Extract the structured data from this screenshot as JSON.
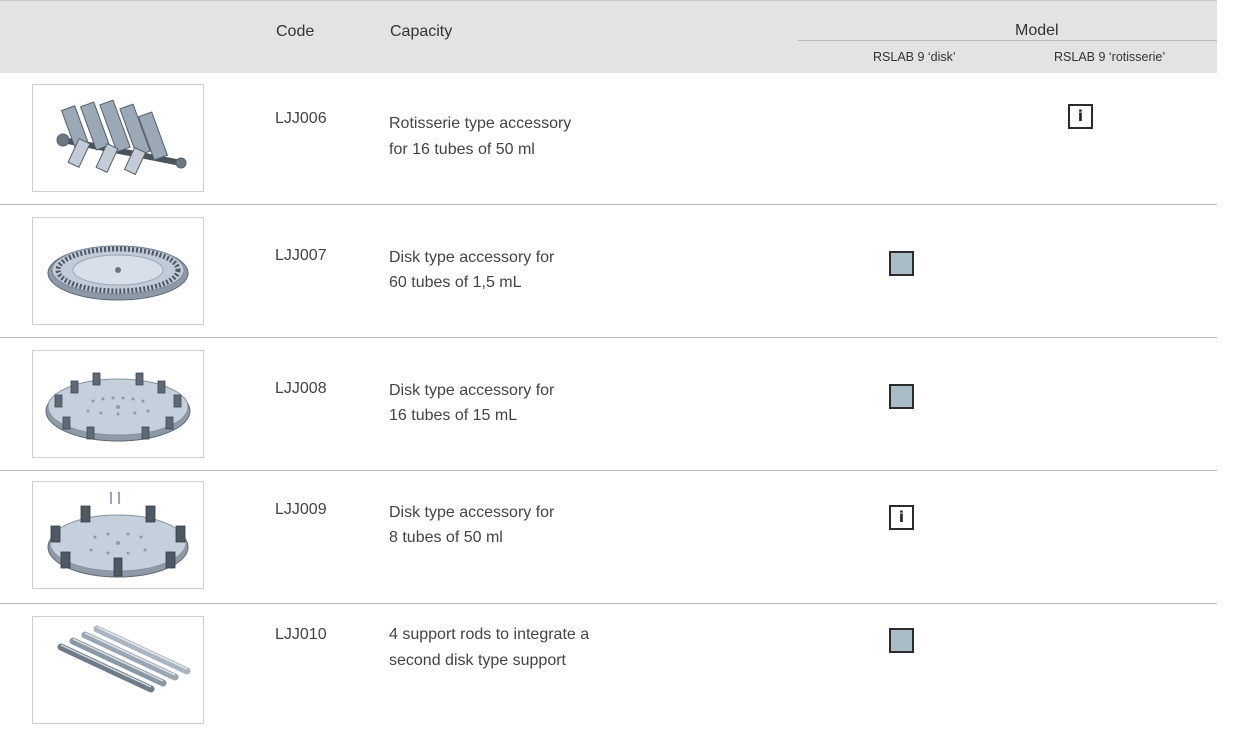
{
  "header": {
    "code": "Code",
    "capacity": "Capacity",
    "model": "Model",
    "model_disk": "RSLAB 9 ‘disk’",
    "model_rotisserie": "RSLAB 9 ‘rotisserie’"
  },
  "rows": [
    {
      "image": "rotisserie-accessory-image",
      "code": "LJJ006",
      "capacity_line1": "Rotisserie type accessory",
      "capacity_line2": "for 16 tubes of 50 ml",
      "disk_mark": "",
      "rotisserie_mark": "i"
    },
    {
      "image": "disk-60-tubes-image",
      "code": "LJJ007",
      "capacity_line1": "Disk type accessory for",
      "capacity_line2": "60 tubes of 1,5 mL",
      "disk_mark": "square",
      "rotisserie_mark": ""
    },
    {
      "image": "disk-16-tubes-image",
      "code": "LJJ008",
      "capacity_line1": "Disk type accessory for",
      "capacity_line2": "16 tubes of 15 mL",
      "disk_mark": "square",
      "rotisserie_mark": ""
    },
    {
      "image": "disk-8-tubes-image",
      "code": "LJJ009",
      "capacity_line1": "Disk type accessory for",
      "capacity_line2": "8 tubes of 50 ml",
      "disk_mark": "i",
      "rotisserie_mark": ""
    },
    {
      "image": "support-rods-image",
      "code": "LJJ010",
      "capacity_line1": "4 support rods to integrate a",
      "capacity_line2": "second disk type support",
      "disk_mark": "square",
      "rotisserie_mark": ""
    }
  ],
  "colors": {
    "header_bg": "#e3e3e3",
    "mark_fill": "#a9bdc9",
    "mark_border": "#2b2b2b"
  }
}
